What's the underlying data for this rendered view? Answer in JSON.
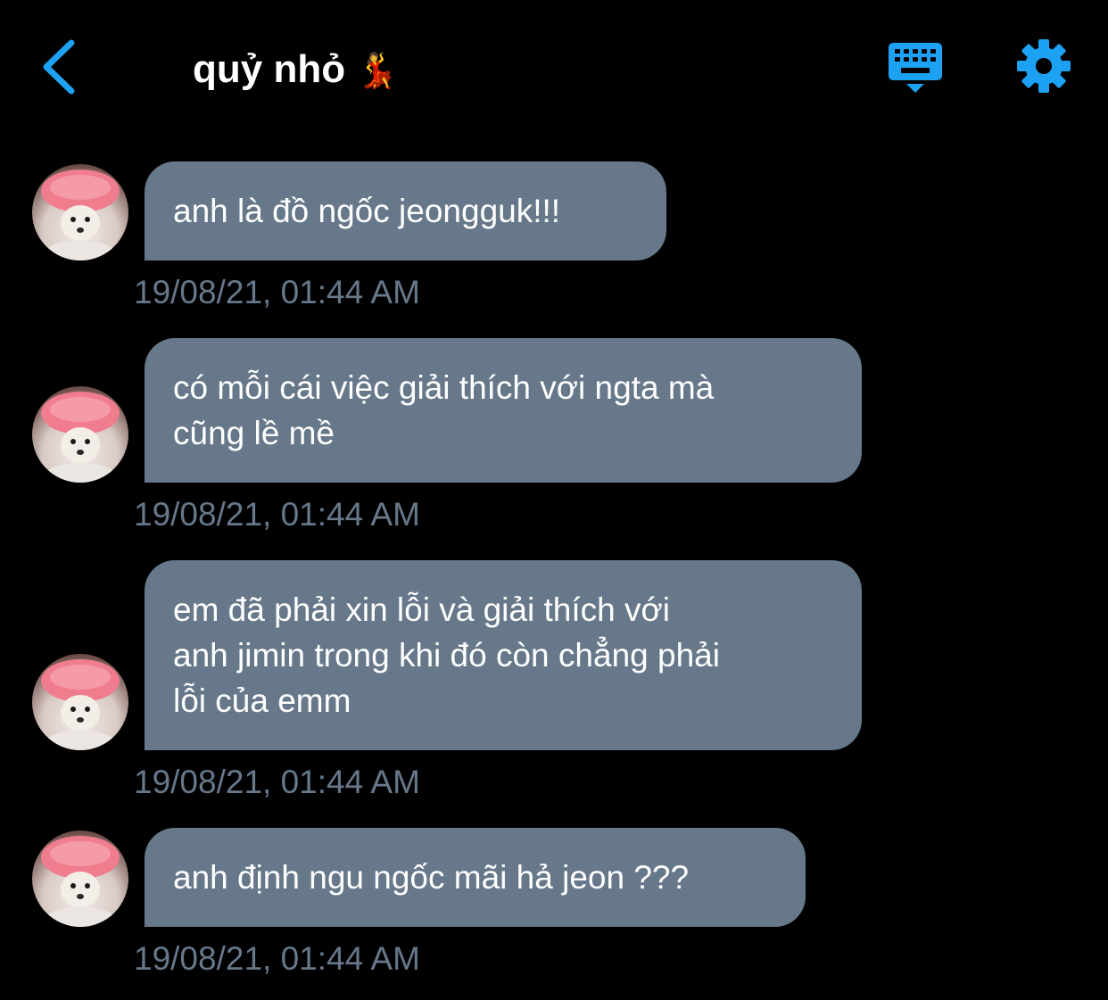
{
  "header": {
    "title": "quỷ nhỏ",
    "title_emoji": "💃",
    "back_icon": "chevron-left-icon",
    "keyboard_icon": "keyboard-icon",
    "settings_icon": "gear-icon",
    "accent_color": "#1da1f2"
  },
  "theme": {
    "background": "#000000",
    "bubble_color": "#66788a",
    "timestamp_color": "#66788a"
  },
  "messages": [
    {
      "text": "anh là đồ ngốc jeongguk!!!",
      "timestamp": "19/08/21, 01:44 AM"
    },
    {
      "text": "có mỗi cái việc giải thích với ngta mà\ncũng lề mề",
      "timestamp": "19/08/21, 01:44 AM"
    },
    {
      "text": "em đã phải xin lỗi và giải thích với\nanh jimin trong khi đó còn chẳng phải\nlỗi của emm",
      "timestamp": "19/08/21, 01:44 AM"
    },
    {
      "text": "anh định ngu ngốc mãi hả jeon ???",
      "timestamp": "19/08/21, 01:44 AM"
    }
  ]
}
